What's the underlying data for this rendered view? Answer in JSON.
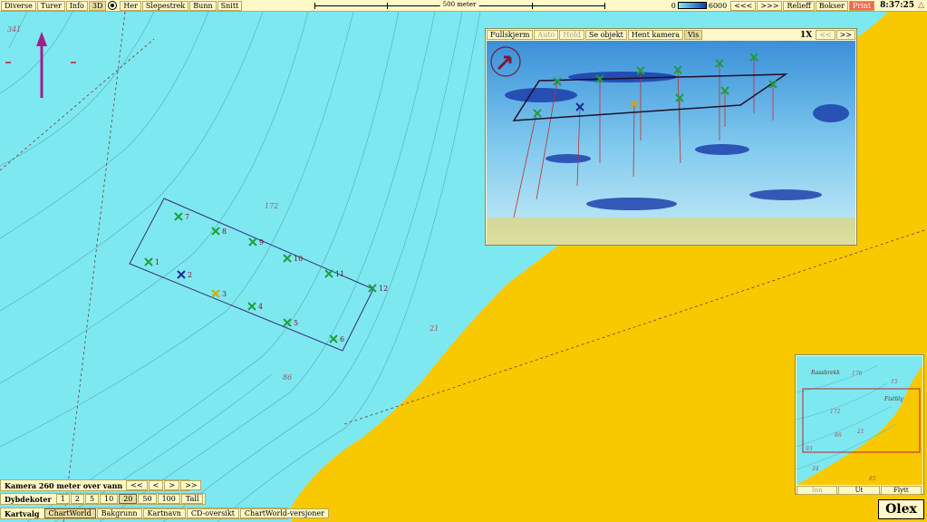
{
  "topbar": {
    "menu": [
      "Diverse",
      "Turer",
      "Info",
      "3D"
    ],
    "menu2": [
      "Her",
      "Slepestrek",
      "Bunn",
      "Snitt"
    ],
    "scale_label": "500 meter",
    "depth_min": "0",
    "depth_max": "6000",
    "nav_back": "<<<",
    "nav_fwd": ">>>",
    "relief": "Relieff",
    "boxes": "Bokser",
    "print": "Print",
    "clock": "8:37:25"
  },
  "map": {
    "depth_numbers": [
      "341",
      "172",
      "86",
      "21"
    ],
    "marks": [
      {
        "id": "7",
        "kind": "green"
      },
      {
        "id": "8",
        "kind": "green"
      },
      {
        "id": "9",
        "kind": "green"
      },
      {
        "id": "1",
        "kind": "green"
      },
      {
        "id": "2",
        "kind": "blue"
      },
      {
        "id": "3",
        "kind": "yellow"
      },
      {
        "id": "10",
        "kind": "green"
      },
      {
        "id": "11",
        "kind": "green"
      },
      {
        "id": "4",
        "kind": "green"
      },
      {
        "id": "5",
        "kind": "green"
      },
      {
        "id": "6",
        "kind": "green"
      },
      {
        "id": "12",
        "kind": "green"
      }
    ]
  },
  "panel3d": {
    "buttons": [
      "Fullskjerm",
      "Auto",
      "Hold",
      "Se objekt",
      "Hent kamera",
      "Vis"
    ],
    "zoom": "1X",
    "prev": "<<",
    "next": ">>"
  },
  "minimap": {
    "labels": [
      "Rassbrekk",
      "176",
      "15",
      "172",
      "Fistbly",
      "86",
      "21",
      "93",
      "34",
      "85"
    ],
    "buttons": [
      "Inn",
      "Ut",
      "Flytt"
    ]
  },
  "controls": {
    "camera": {
      "title": "Kamera 260 meter over vann",
      "buttons": [
        "<<",
        "<",
        ">",
        ">>"
      ]
    },
    "contours": {
      "title": "Dybdekoter",
      "buttons": [
        "1",
        "2",
        "5",
        "10",
        "20",
        "50",
        "100",
        "Tall"
      ],
      "selected": "20"
    },
    "charts": {
      "title": "Kartvalg",
      "buttons": [
        "ChartWorld",
        "Bakgrunn",
        "Kartnavn",
        "CD-oversikt",
        "ChartWorld-versjoner"
      ],
      "selected": "ChartWorld"
    }
  },
  "brand": "Olex",
  "colors": {
    "sea": "#7ee8f0",
    "land": "#f8c800",
    "contour": "#5fb8c8",
    "mark_green": "#1e9e3c",
    "mark_blue": "#1a2a9a",
    "mark_yellow": "#d4a800",
    "ui_bg": "#fff8c8"
  }
}
